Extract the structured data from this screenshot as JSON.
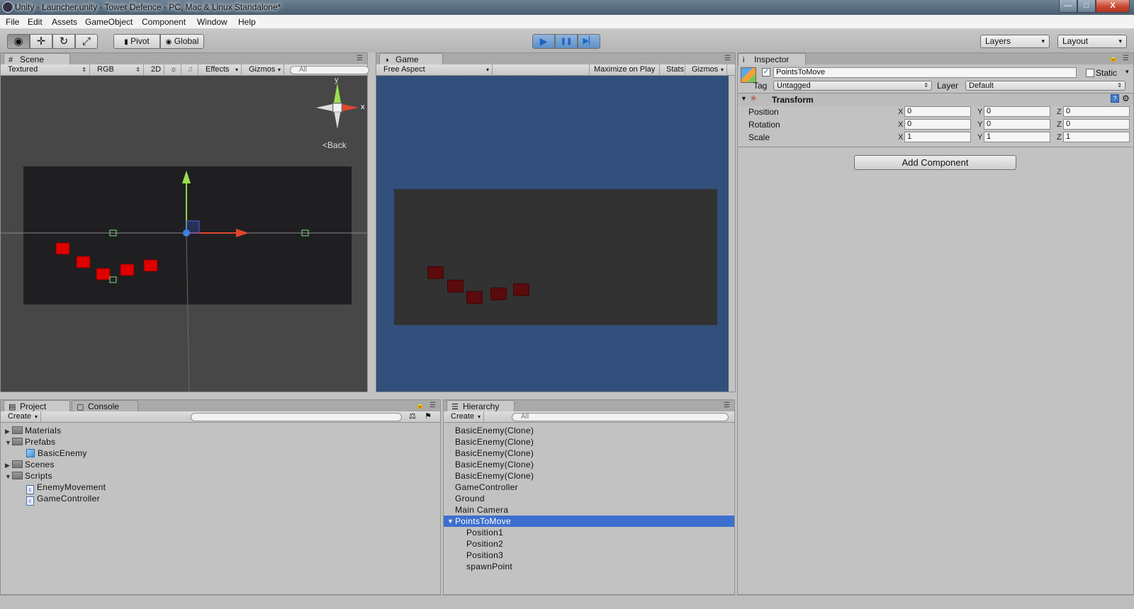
{
  "window": {
    "title": "Unity - Launcher.unity - Tower Defence - PC, Mac & Linux Standalone*",
    "min_glyph": "—",
    "max_glyph": "□",
    "close_glyph": "X"
  },
  "menu": [
    "File",
    "Edit",
    "Assets",
    "GameObject",
    "Component",
    "Window",
    "Help"
  ],
  "toolbar": {
    "tool_glyphs": [
      "◉",
      "✛",
      "↻",
      "⤢"
    ],
    "pivot_label": "Pivot",
    "global_label": "Global",
    "play_glyphs": [
      "▶",
      "❚❚",
      "▶▏"
    ],
    "layers_label": "Layers",
    "layout_label": "Layout",
    "dropdown_arrow": "▾"
  },
  "scene": {
    "tab_label": "Scene",
    "tab_icon": "#",
    "render_mode": "Textured",
    "color_mode": "RGB",
    "two_d": "2D",
    "light_glyph": "☼",
    "audio_glyph": "♫",
    "effects_label": "Effects",
    "gizmos_label": "Gizmos",
    "search_placeholder": "All",
    "gizmo_axis_y": "y",
    "gizmo_axis_x": "x",
    "back_label": "Back"
  },
  "game": {
    "tab_label": "Game",
    "tab_icon": "◑",
    "aspect": "Free Aspect",
    "maximize_label": "Maximize on Play",
    "stats_label": "Stats",
    "gizmos_label": "Gizmos"
  },
  "inspector": {
    "tab_label": "Inspector",
    "tab_icon": "i",
    "object_name": "PointsToMove",
    "static_label": "Static",
    "tag_label": "Tag",
    "tag_value": "Untagged",
    "layer_label": "Layer",
    "layer_value": "Default",
    "component_title": "Transform",
    "rows": [
      {
        "label": "Position",
        "x": "0",
        "y": "0",
        "z": "0"
      },
      {
        "label": "Rotation",
        "x": "0",
        "y": "0",
        "z": "0"
      },
      {
        "label": "Scale",
        "x": "1",
        "y": "1",
        "z": "1"
      }
    ],
    "axis_x": "X",
    "axis_y": "Y",
    "axis_z": "Z",
    "add_component_label": "Add Component",
    "active_check": "✓"
  },
  "project": {
    "tab_label": "Project",
    "tab_icon": "▤",
    "console_label": "Console",
    "console_icon": "▢",
    "create_label": "Create",
    "tree": [
      {
        "label": "Materials",
        "type": "folder",
        "depth": 0,
        "expanded": false
      },
      {
        "label": "Prefabs",
        "type": "folder",
        "depth": 0,
        "expanded": true
      },
      {
        "label": "BasicEnemy",
        "type": "prefab",
        "depth": 1
      },
      {
        "label": "Scenes",
        "type": "folder",
        "depth": 0,
        "expanded": false
      },
      {
        "label": "Scripts",
        "type": "folder",
        "depth": 0,
        "expanded": true
      },
      {
        "label": "EnemyMovement",
        "type": "script",
        "depth": 1
      },
      {
        "label": "GameController",
        "type": "script",
        "depth": 1
      }
    ]
  },
  "hierarchy": {
    "tab_label": "Hierarchy",
    "tab_icon": "☰",
    "create_label": "Create",
    "search_placeholder": "All",
    "items": [
      {
        "label": "BasicEnemy(Clone)",
        "depth": 0
      },
      {
        "label": "BasicEnemy(Clone)",
        "depth": 0
      },
      {
        "label": "BasicEnemy(Clone)",
        "depth": 0
      },
      {
        "label": "BasicEnemy(Clone)",
        "depth": 0
      },
      {
        "label": "BasicEnemy(Clone)",
        "depth": 0
      },
      {
        "label": "GameController",
        "depth": 0
      },
      {
        "label": "Ground",
        "depth": 0
      },
      {
        "label": "Main Camera",
        "depth": 0
      },
      {
        "label": "PointsToMove",
        "depth": 0,
        "selected": true,
        "expanded": true
      },
      {
        "label": "Position1",
        "depth": 1
      },
      {
        "label": "Position2",
        "depth": 1
      },
      {
        "label": "Position3",
        "depth": 1
      },
      {
        "label": "spawnPoint",
        "depth": 1
      }
    ]
  },
  "colors": {
    "selection": "#3d6fce",
    "play_accent": "#1d63c4",
    "cube_red": "#e00000",
    "game_bg": "#324f7b"
  }
}
